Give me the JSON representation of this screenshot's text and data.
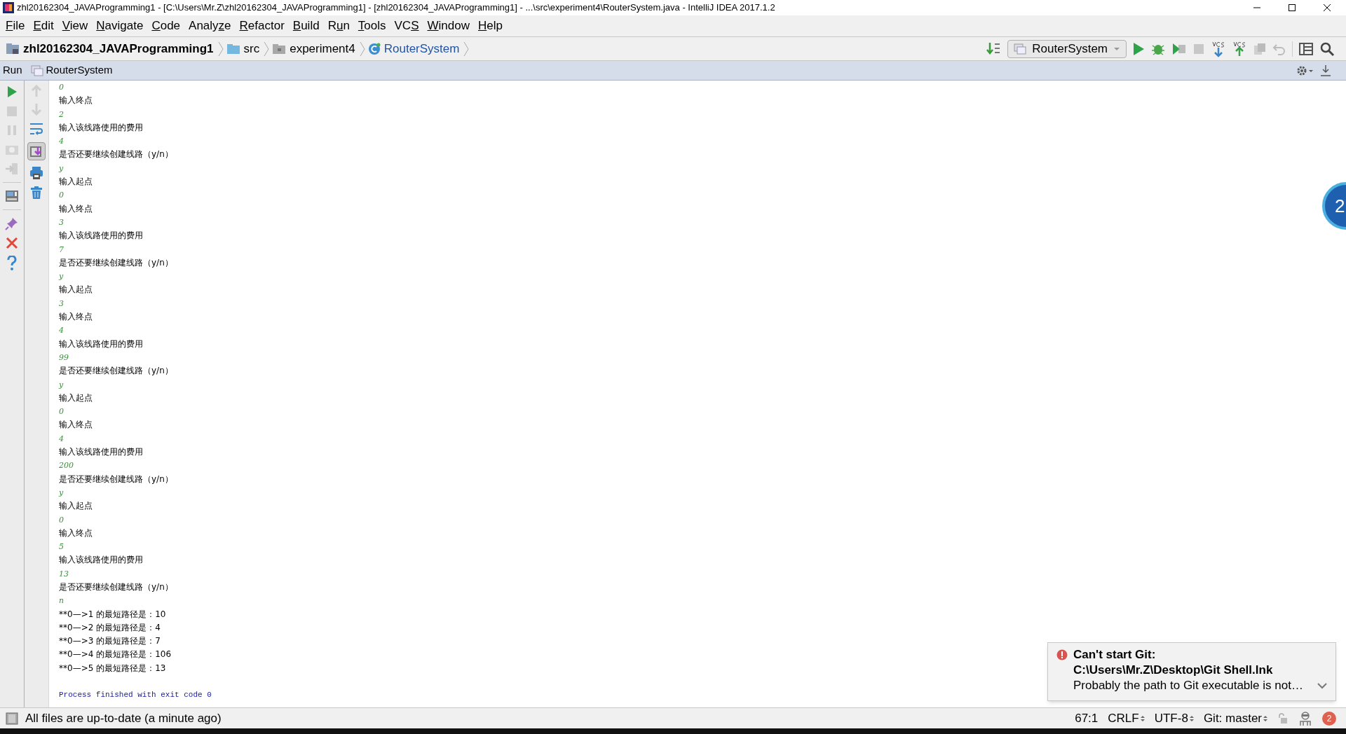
{
  "window": {
    "title": "zhl20162304_JAVAProgramming1 - [C:\\Users\\Mr.Z\\zhl20162304_JAVAProgramming1] - [zhl20162304_JAVAProgramming1] - ...\\src\\experiment4\\RouterSystem.java - IntelliJ IDEA 2017.1.2"
  },
  "menu": [
    {
      "parts": [
        {
          "text": "F",
          "underlined": true
        },
        {
          "text": "ile",
          "underlined": false
        }
      ]
    },
    {
      "parts": [
        {
          "text": "E",
          "underlined": true
        },
        {
          "text": "dit",
          "underlined": false
        }
      ]
    },
    {
      "parts": [
        {
          "text": "V",
          "underlined": true
        },
        {
          "text": "iew",
          "underlined": false
        }
      ]
    },
    {
      "parts": [
        {
          "text": "N",
          "underlined": true
        },
        {
          "text": "avigate",
          "underlined": false
        }
      ]
    },
    {
      "parts": [
        {
          "text": "C",
          "underlined": true
        },
        {
          "text": "ode",
          "underlined": false
        }
      ]
    },
    {
      "parts": [
        {
          "text": "Analy",
          "underlined": false
        },
        {
          "text": "z",
          "underlined": true
        },
        {
          "text": "e",
          "underlined": false
        }
      ]
    },
    {
      "parts": [
        {
          "text": "R",
          "underlined": true
        },
        {
          "text": "efactor",
          "underlined": false
        }
      ]
    },
    {
      "parts": [
        {
          "text": "B",
          "underlined": true
        },
        {
          "text": "uild",
          "underlined": false
        }
      ]
    },
    {
      "parts": [
        {
          "text": "R",
          "underlined": false
        },
        {
          "text": "u",
          "underlined": true
        },
        {
          "text": "n",
          "underlined": false
        }
      ]
    },
    {
      "parts": [
        {
          "text": "T",
          "underlined": true
        },
        {
          "text": "ools",
          "underlined": false
        }
      ]
    },
    {
      "parts": [
        {
          "text": "VC",
          "underlined": false
        },
        {
          "text": "S",
          "underlined": true
        }
      ]
    },
    {
      "parts": [
        {
          "text": "W",
          "underlined": true
        },
        {
          "text": "indow",
          "underlined": false
        }
      ]
    },
    {
      "parts": [
        {
          "text": "H",
          "underlined": true
        },
        {
          "text": "elp",
          "underlined": false
        }
      ]
    }
  ],
  "breadcrumbs": [
    {
      "label": "zhl20162304_JAVAProgramming1",
      "kind": "project"
    },
    {
      "label": "src",
      "kind": "folder"
    },
    {
      "label": "experiment4",
      "kind": "package"
    },
    {
      "label": "RouterSystem",
      "kind": "class"
    }
  ],
  "run_config": "RouterSystem",
  "run_panel": {
    "label": "Run",
    "tab": "RouterSystem",
    "scroll_to_end_on": true
  },
  "console": [
    {
      "text": "0",
      "kind": "input"
    },
    {
      "text": "输入终点",
      "kind": "output"
    },
    {
      "text": "2",
      "kind": "input"
    },
    {
      "text": "输入该线路使用的费用",
      "kind": "output"
    },
    {
      "text": "4",
      "kind": "input"
    },
    {
      "text": "是否还要继续创建线路（y/n）",
      "kind": "output"
    },
    {
      "text": "y",
      "kind": "input"
    },
    {
      "text": "输入起点",
      "kind": "output"
    },
    {
      "text": "0",
      "kind": "input"
    },
    {
      "text": "输入终点",
      "kind": "output"
    },
    {
      "text": "3",
      "kind": "input"
    },
    {
      "text": "输入该线路使用的费用",
      "kind": "output"
    },
    {
      "text": "7",
      "kind": "input"
    },
    {
      "text": "是否还要继续创建线路（y/n）",
      "kind": "output"
    },
    {
      "text": "y",
      "kind": "input"
    },
    {
      "text": "输入起点",
      "kind": "output"
    },
    {
      "text": "3",
      "kind": "input"
    },
    {
      "text": "输入终点",
      "kind": "output"
    },
    {
      "text": "4",
      "kind": "input"
    },
    {
      "text": "输入该线路使用的费用",
      "kind": "output"
    },
    {
      "text": "99",
      "kind": "input"
    },
    {
      "text": "是否还要继续创建线路（y/n）",
      "kind": "output"
    },
    {
      "text": "y",
      "kind": "input"
    },
    {
      "text": "输入起点",
      "kind": "output"
    },
    {
      "text": "0",
      "kind": "input"
    },
    {
      "text": "输入终点",
      "kind": "output"
    },
    {
      "text": "4",
      "kind": "input"
    },
    {
      "text": "输入该线路使用的费用",
      "kind": "output"
    },
    {
      "text": "200",
      "kind": "input"
    },
    {
      "text": "是否还要继续创建线路（y/n）",
      "kind": "output"
    },
    {
      "text": "y",
      "kind": "input"
    },
    {
      "text": "输入起点",
      "kind": "output"
    },
    {
      "text": "0",
      "kind": "input"
    },
    {
      "text": "输入终点",
      "kind": "output"
    },
    {
      "text": "5",
      "kind": "input"
    },
    {
      "text": "输入该线路使用的费用",
      "kind": "output"
    },
    {
      "text": "13",
      "kind": "input"
    },
    {
      "text": "是否还要继续创建线路（y/n）",
      "kind": "output"
    },
    {
      "text": "n",
      "kind": "input"
    },
    {
      "text": "**0—>1 的最短路径是：10",
      "kind": "output"
    },
    {
      "text": "**0—>2 的最短路径是：4",
      "kind": "output"
    },
    {
      "text": "**0—>3 的最短路径是：7",
      "kind": "output"
    },
    {
      "text": "**0—>4 的最短路径是：106",
      "kind": "output"
    },
    {
      "text": "**0—>5 的最短路径是：13",
      "kind": "output"
    },
    {
      "text": "Process finished with exit code 0",
      "kind": "system"
    }
  ],
  "floating_badge": "2",
  "notification": {
    "title": "Can't start Git:",
    "path": "C:\\Users\\Mr.Z\\Desktop\\Git Shell.lnk",
    "message": "Probably the path to Git executable is not…"
  },
  "status_bar": {
    "message": "All files are up-to-date (a minute ago)",
    "position": "67:1",
    "line_separator": "CRLF",
    "encoding": "UTF-8",
    "vcs_branch": "Git: master",
    "event_count": "2"
  }
}
